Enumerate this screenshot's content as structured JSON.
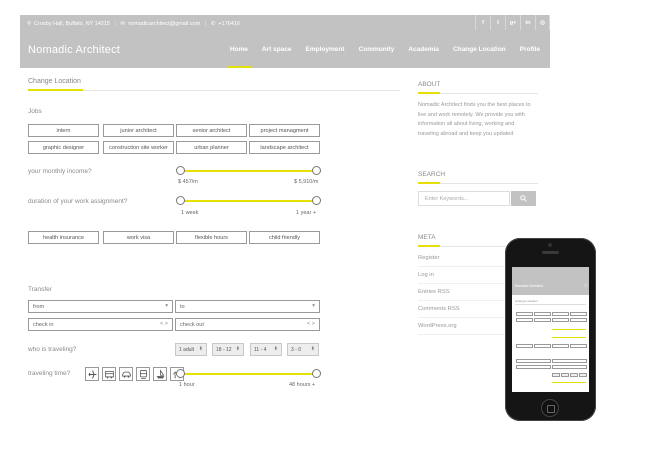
{
  "header": {
    "contact": {
      "address": "Crosby Hall, Buffalo, NY 14215",
      "email": "nomadicarchitect@gmail.com",
      "phone": "+176416"
    },
    "brand": "Nomadic Architect",
    "nav": [
      "Home",
      "Art space",
      "Employment",
      "Community",
      "Academia",
      "Change Location",
      "Profile"
    ],
    "active_nav": "Home",
    "social_icons": [
      "facebook-icon",
      "twitter-icon",
      "google-plus-icon",
      "linkedin-icon",
      "instagram-icon"
    ],
    "social_glyphs": [
      "f",
      "t",
      "g+",
      "in",
      "◎"
    ]
  },
  "main": {
    "title": "Change Location",
    "jobs": {
      "label": "Jobs",
      "options": [
        "intern",
        "junior architect",
        "senior architect",
        "project managment",
        "graphic designer",
        "construction site worker",
        "urban planner",
        "landscape architect"
      ]
    },
    "income": {
      "question": "your monthly income?",
      "min_label": "$ 457/m",
      "max_label": "$ 5,910/m",
      "range_fraction": [
        0,
        1
      ]
    },
    "duration": {
      "question": "duration of your work assignment?",
      "min_label": "1 week",
      "max_label": "1 year +",
      "range_fraction": [
        0,
        1
      ]
    },
    "perks": [
      "health insurance",
      "work visa",
      "flexible hours",
      "child friendly"
    ],
    "transfer": {
      "label": "Transfer",
      "from_placeholder": "from",
      "to_placeholder": "to",
      "checkin_placeholder": "check in",
      "checkout_placeholder": "check out",
      "dropdown_arrow": "▾",
      "date_arrows": "< >"
    },
    "travelers": {
      "question": "who is traveling?",
      "selects": [
        "1 adult",
        "18 - 12",
        "11 - 4",
        "3 - 0"
      ],
      "select_arrow": "⬍"
    },
    "travel_time": {
      "question": "traveling time?",
      "vehicles": [
        "airplane-icon",
        "bus-icon",
        "car-icon",
        "train-icon",
        "boat-icon",
        "camel-icon"
      ],
      "min_label": "1 hour",
      "max_label": "48 hours +",
      "range_fraction": [
        0,
        1
      ]
    }
  },
  "sidebar": {
    "about": {
      "heading": "ABOUT",
      "text": "Nomadic Architect finds you the best places to live and work remotely. We provide you with information all about living, working and traveling abroad and keep you updated"
    },
    "search": {
      "heading": "SEARCH",
      "placeholder": "Enter Keywords..."
    },
    "meta": {
      "heading": "META",
      "links": [
        "Register",
        "Log in",
        "Entries RSS",
        "Comments RSS",
        "WordPress.org"
      ]
    }
  },
  "colors": {
    "accent": "#e5e000",
    "header_bg": "#c2c2c2",
    "border": "#9a9a9a"
  }
}
